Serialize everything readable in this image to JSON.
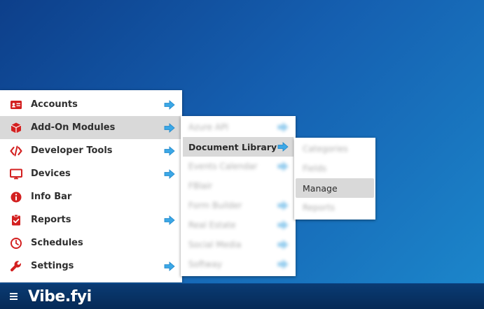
{
  "colors": {
    "accent_red": "#d32020",
    "arrow_blue": "#3ba7e6",
    "active_row": "#d9d9d9",
    "taskbar": "#062a57"
  },
  "main_menu": {
    "items": [
      {
        "label": "Accounts",
        "icon": "id-card-icon",
        "has_submenu": true
      },
      {
        "label": "Add-On Modules",
        "icon": "cube-icon",
        "has_submenu": true,
        "active": true
      },
      {
        "label": "Developer Tools",
        "icon": "code-icon",
        "has_submenu": true
      },
      {
        "label": "Devices",
        "icon": "monitor-icon",
        "has_submenu": true
      },
      {
        "label": "Info Bar",
        "icon": "info-icon",
        "has_submenu": false
      },
      {
        "label": "Reports",
        "icon": "clipboard-check-icon",
        "has_submenu": true
      },
      {
        "label": "Schedules",
        "icon": "clock-icon",
        "has_submenu": false
      },
      {
        "label": "Settings",
        "icon": "wrench-icon",
        "has_submenu": true
      }
    ]
  },
  "submenu_addons": {
    "items": [
      {
        "label": "Azure API",
        "has_submenu": true,
        "blurred": true
      },
      {
        "label": "Document Library",
        "has_submenu": true,
        "active": true
      },
      {
        "label": "Events Calendar",
        "has_submenu": true,
        "blurred": true
      },
      {
        "label": "FBlair",
        "has_submenu": false,
        "blurred": true
      },
      {
        "label": "Form Builder",
        "has_submenu": true,
        "blurred": true
      },
      {
        "label": "Real Estate",
        "has_submenu": true,
        "blurred": true
      },
      {
        "label": "Social Media",
        "has_submenu": true,
        "blurred": true
      },
      {
        "label": "Softway",
        "has_submenu": true,
        "blurred": true
      }
    ]
  },
  "submenu_document_library": {
    "items": [
      {
        "label": "Categories",
        "blurred": true
      },
      {
        "label": "Fields",
        "blurred": true
      },
      {
        "label": "Manage",
        "active": true
      },
      {
        "label": "Reports",
        "blurred": true
      }
    ]
  },
  "taskbar": {
    "menu_icon": "hamburger-icon",
    "brand": "Vibe.fyi"
  }
}
